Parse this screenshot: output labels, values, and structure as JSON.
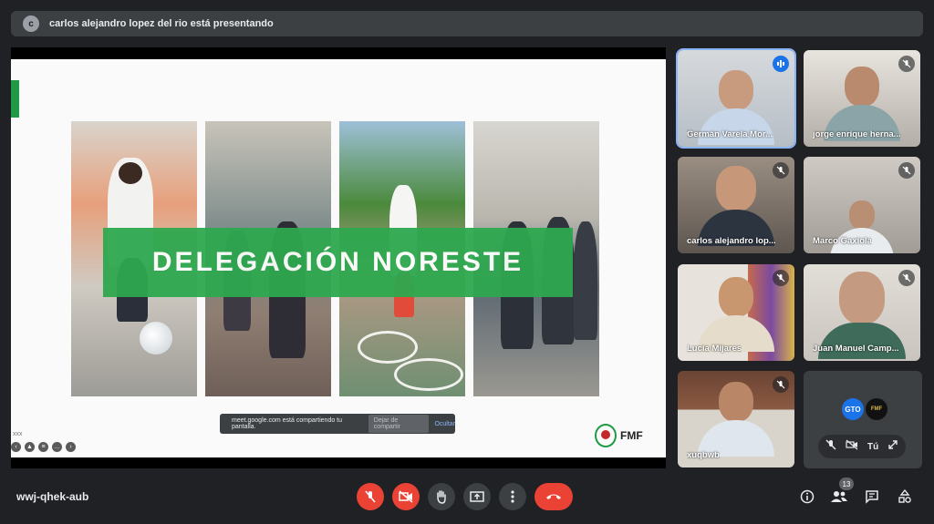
{
  "banner": {
    "avatar_letter": "c",
    "text": "carlos alejandro lopez del rio está presentando"
  },
  "slide": {
    "title": "DELEGACIÓN NORESTE",
    "logo_text": "FMF",
    "share_bar": {
      "message": "meet.google.com está compartiendo tu pantalla.",
      "stop_label": "Dejar de compartir",
      "hide_label": "Ocultar"
    },
    "corner_text": "xxx"
  },
  "participants": [
    {
      "name": "Germán Varela Mor...",
      "status": "speaking"
    },
    {
      "name": "jorge enrique herna...",
      "status": "muted"
    },
    {
      "name": "carlos alejandro lop...",
      "status": "muted"
    },
    {
      "name": "Marco Gaxiola",
      "status": "muted"
    },
    {
      "name": "Lucía Mijares",
      "status": "muted"
    },
    {
      "name": "Juan Manuel Camp...",
      "status": "muted"
    },
    {
      "name": "xuqbwb",
      "status": "muted"
    }
  ],
  "self_tile": {
    "label": "Tú",
    "avatar1": "GTO",
    "avatar2": "FMF"
  },
  "bottom_bar": {
    "meeting_code": "wwj-qhek-aub",
    "participant_count": "13"
  },
  "colors": {
    "accent_green": "#2ea84f",
    "end_red": "#ea4335",
    "speaking_blue": "#8ab4f8"
  }
}
